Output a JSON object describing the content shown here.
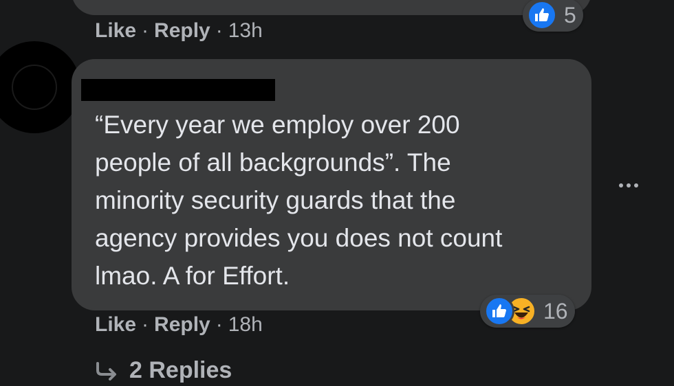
{
  "previous_comment": {
    "actions": {
      "like_label": "Like",
      "reply_label": "Reply",
      "separator": "·",
      "time": "13h"
    },
    "reactions": {
      "types": [
        "like"
      ],
      "count": "5"
    }
  },
  "comment": {
    "text": "“Every year we employ over 200\npeople of all backgrounds”. The\nminority security guards that the\nagency provides you does not count\nlmao. A for Effort.",
    "actions": {
      "like_label": "Like",
      "reply_label": "Reply",
      "separator": "·",
      "time": "18h"
    },
    "reactions": {
      "types": [
        "like",
        "haha"
      ],
      "count": "16"
    },
    "replies_label": "2 Replies"
  },
  "colors": {
    "background": "#18191a",
    "bubble": "#3a3b3c",
    "text_primary": "#e4e6eb",
    "text_secondary": "#b0b3b8",
    "like_blue": "#1877f2",
    "haha_yellow": "#f7b125"
  },
  "icons": {
    "like": "thumbs-up-icon",
    "haha": "laughing-face-icon",
    "more": "more-options-icon",
    "reply_arrow": "reply-arrow-icon"
  }
}
